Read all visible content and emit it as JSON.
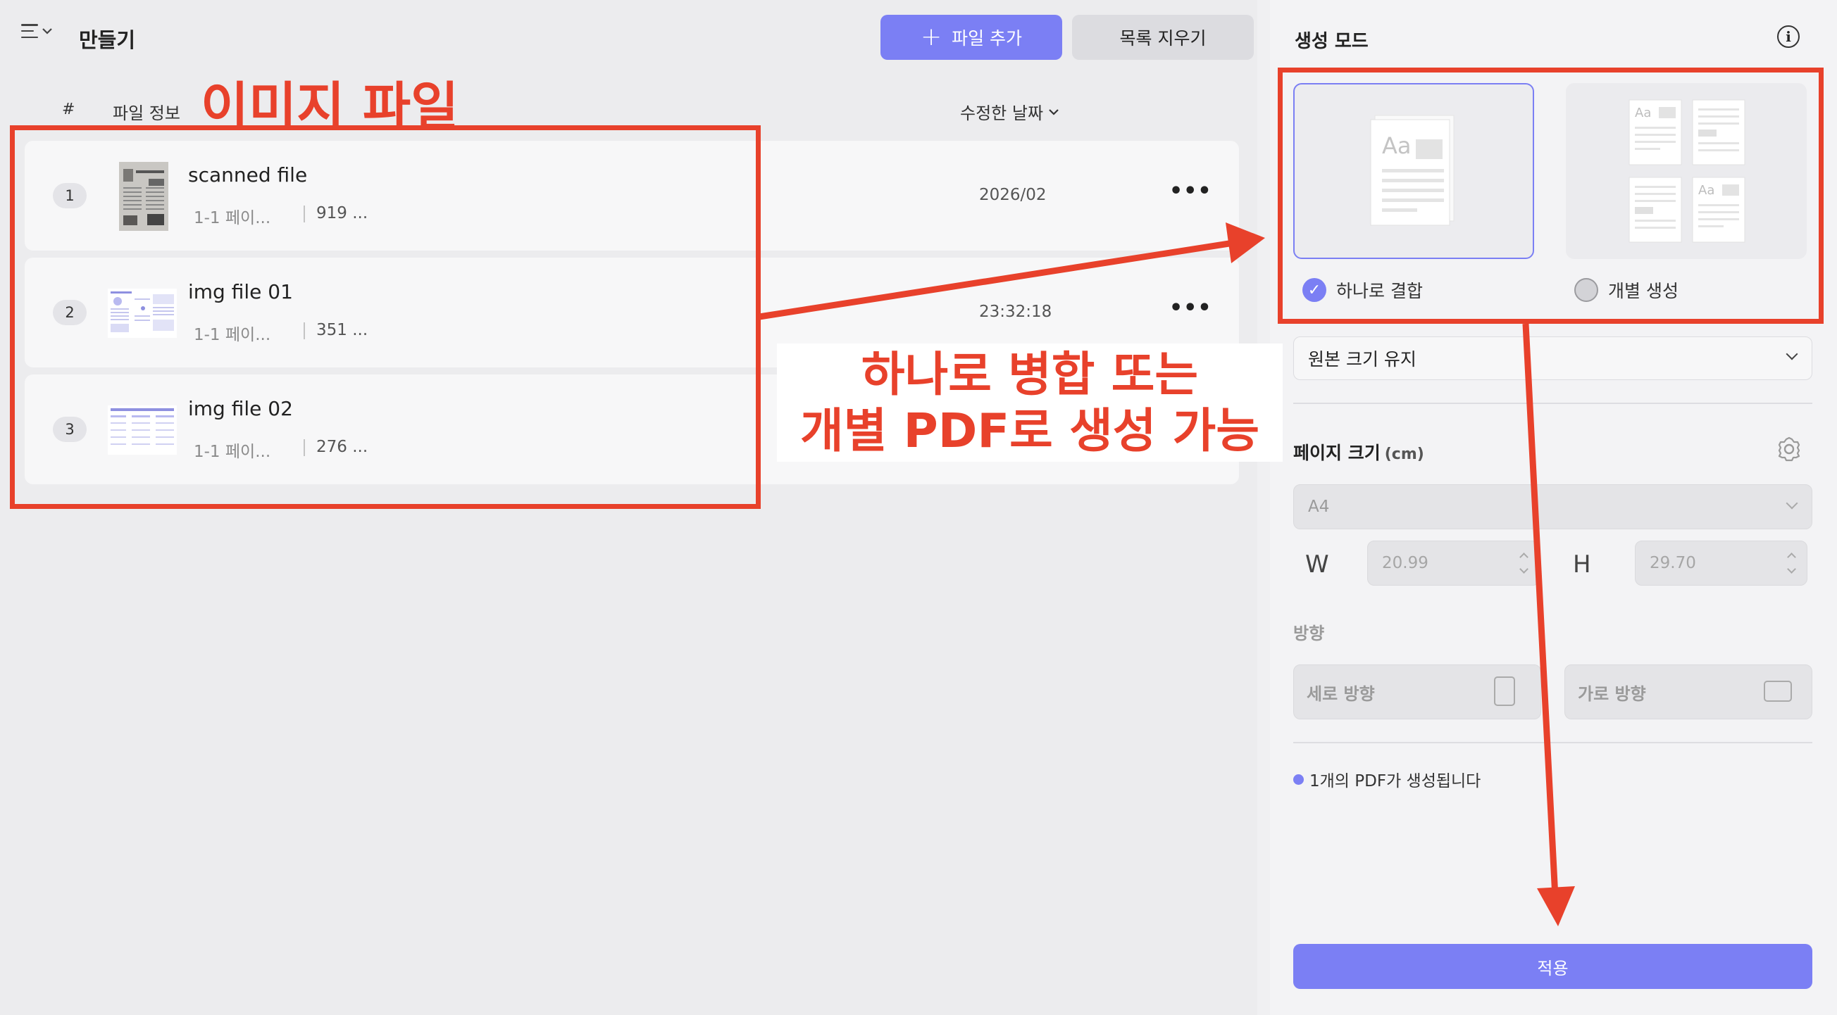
{
  "header": {
    "title": "만들기",
    "add_file": "파일 추가",
    "clear_list": "목록 지우기"
  },
  "table": {
    "col_num": "#",
    "col_info": "파일 정보",
    "col_date": "수정한 날짜"
  },
  "files": [
    {
      "index": "1",
      "name": "scanned file",
      "pages": "1-1 페이...",
      "size": "919 ...",
      "date": "2026/02"
    },
    {
      "index": "2",
      "name": "img file 01",
      "pages": "1-1 페이...",
      "size": "351 ...",
      "date": "23:32:18"
    },
    {
      "index": "3",
      "name": "img file 02",
      "pages": "1-1 페이...",
      "size": "276 ..."
    }
  ],
  "panel": {
    "title": "생성 모드",
    "mode_combine": "하나로 결합",
    "mode_separate": "개별 생성",
    "size_option": "원본 크기 유지",
    "page_size_label": "페이지 크기",
    "page_size_unit": "(cm)",
    "paper": "A4",
    "w_label": "W",
    "h_label": "H",
    "width": "20.99",
    "height": "29.70",
    "orientation_label": "방향",
    "portrait": "세로 방향",
    "landscape": "가로 방향",
    "result_info": "1개의 PDF가 생성됩니다",
    "apply": "적용"
  },
  "annotations": {
    "image_files": "이미지 파일",
    "callout_line1": "하나로 병합 또는",
    "callout_line2": "개별 PDF로 생성 가능"
  },
  "colors": {
    "accent": "#7b7ff4",
    "annotation": "#e8412b"
  }
}
